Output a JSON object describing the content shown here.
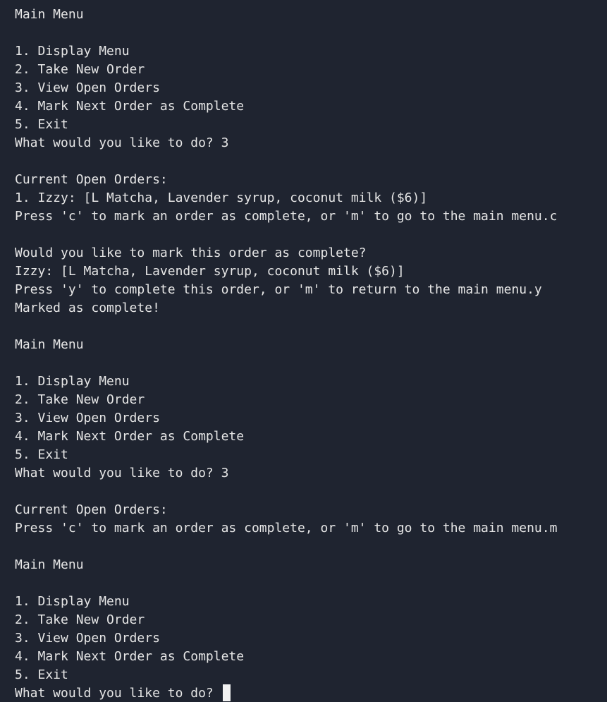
{
  "terminal": {
    "lines": [
      "Main Menu",
      "",
      "1. Display Menu",
      "2. Take New Order",
      "3. View Open Orders",
      "4. Mark Next Order as Complete",
      "5. Exit",
      "What would you like to do? 3",
      "",
      "Current Open Orders:",
      "1. Izzy: [L Matcha, Lavender syrup, coconut milk ($6)]",
      "Press 'c' to mark an order as complete, or 'm' to go to the main menu.c",
      "",
      "Would you like to mark this order as complete?",
      "Izzy: [L Matcha, Lavender syrup, coconut milk ($6)]",
      "Press 'y' to complete this order, or 'm' to return to the main menu.y",
      "Marked as complete!",
      "",
      "Main Menu",
      "",
      "1. Display Menu",
      "2. Take New Order",
      "3. View Open Orders",
      "4. Mark Next Order as Complete",
      "5. Exit",
      "What would you like to do? 3",
      "",
      "Current Open Orders:",
      "Press 'c' to mark an order as complete, or 'm' to go to the main menu.m",
      "",
      "Main Menu",
      "",
      "1. Display Menu",
      "2. Take New Order",
      "3. View Open Orders",
      "4. Mark Next Order as Complete",
      "5. Exit",
      "What would you like to do? "
    ]
  }
}
